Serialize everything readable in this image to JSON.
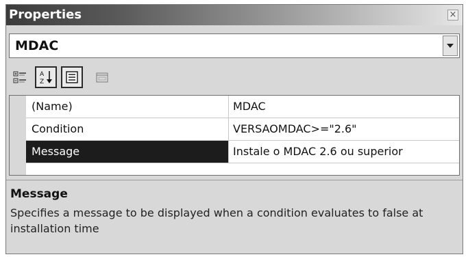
{
  "window": {
    "title": "Properties",
    "close_symbol": "×"
  },
  "object_selector": {
    "value": "MDAC"
  },
  "toolbar": {
    "buttons": [
      {
        "icon": "categorized-icon",
        "pressed": false
      },
      {
        "icon": "alphabetical-sort-icon",
        "pressed": true
      },
      {
        "icon": "properties-icon",
        "pressed": true
      },
      {
        "icon": "property-pages-icon",
        "pressed": false
      }
    ]
  },
  "grid": {
    "rows": [
      {
        "name": "(Name)",
        "value": "MDAC"
      },
      {
        "name": "Condition",
        "value": "VERSAOMDAC>=\"2.6\""
      },
      {
        "name": "Message",
        "value": "Instale o MDAC 2.6 ou superior",
        "selected": true
      }
    ]
  },
  "description": {
    "title": "Message",
    "text": "Specifies a message to be displayed when a condition evaluates to false at installation time"
  },
  "colors": {
    "selection_bg": "#1c1c1c",
    "panel_bg": "#d8d8d8"
  }
}
